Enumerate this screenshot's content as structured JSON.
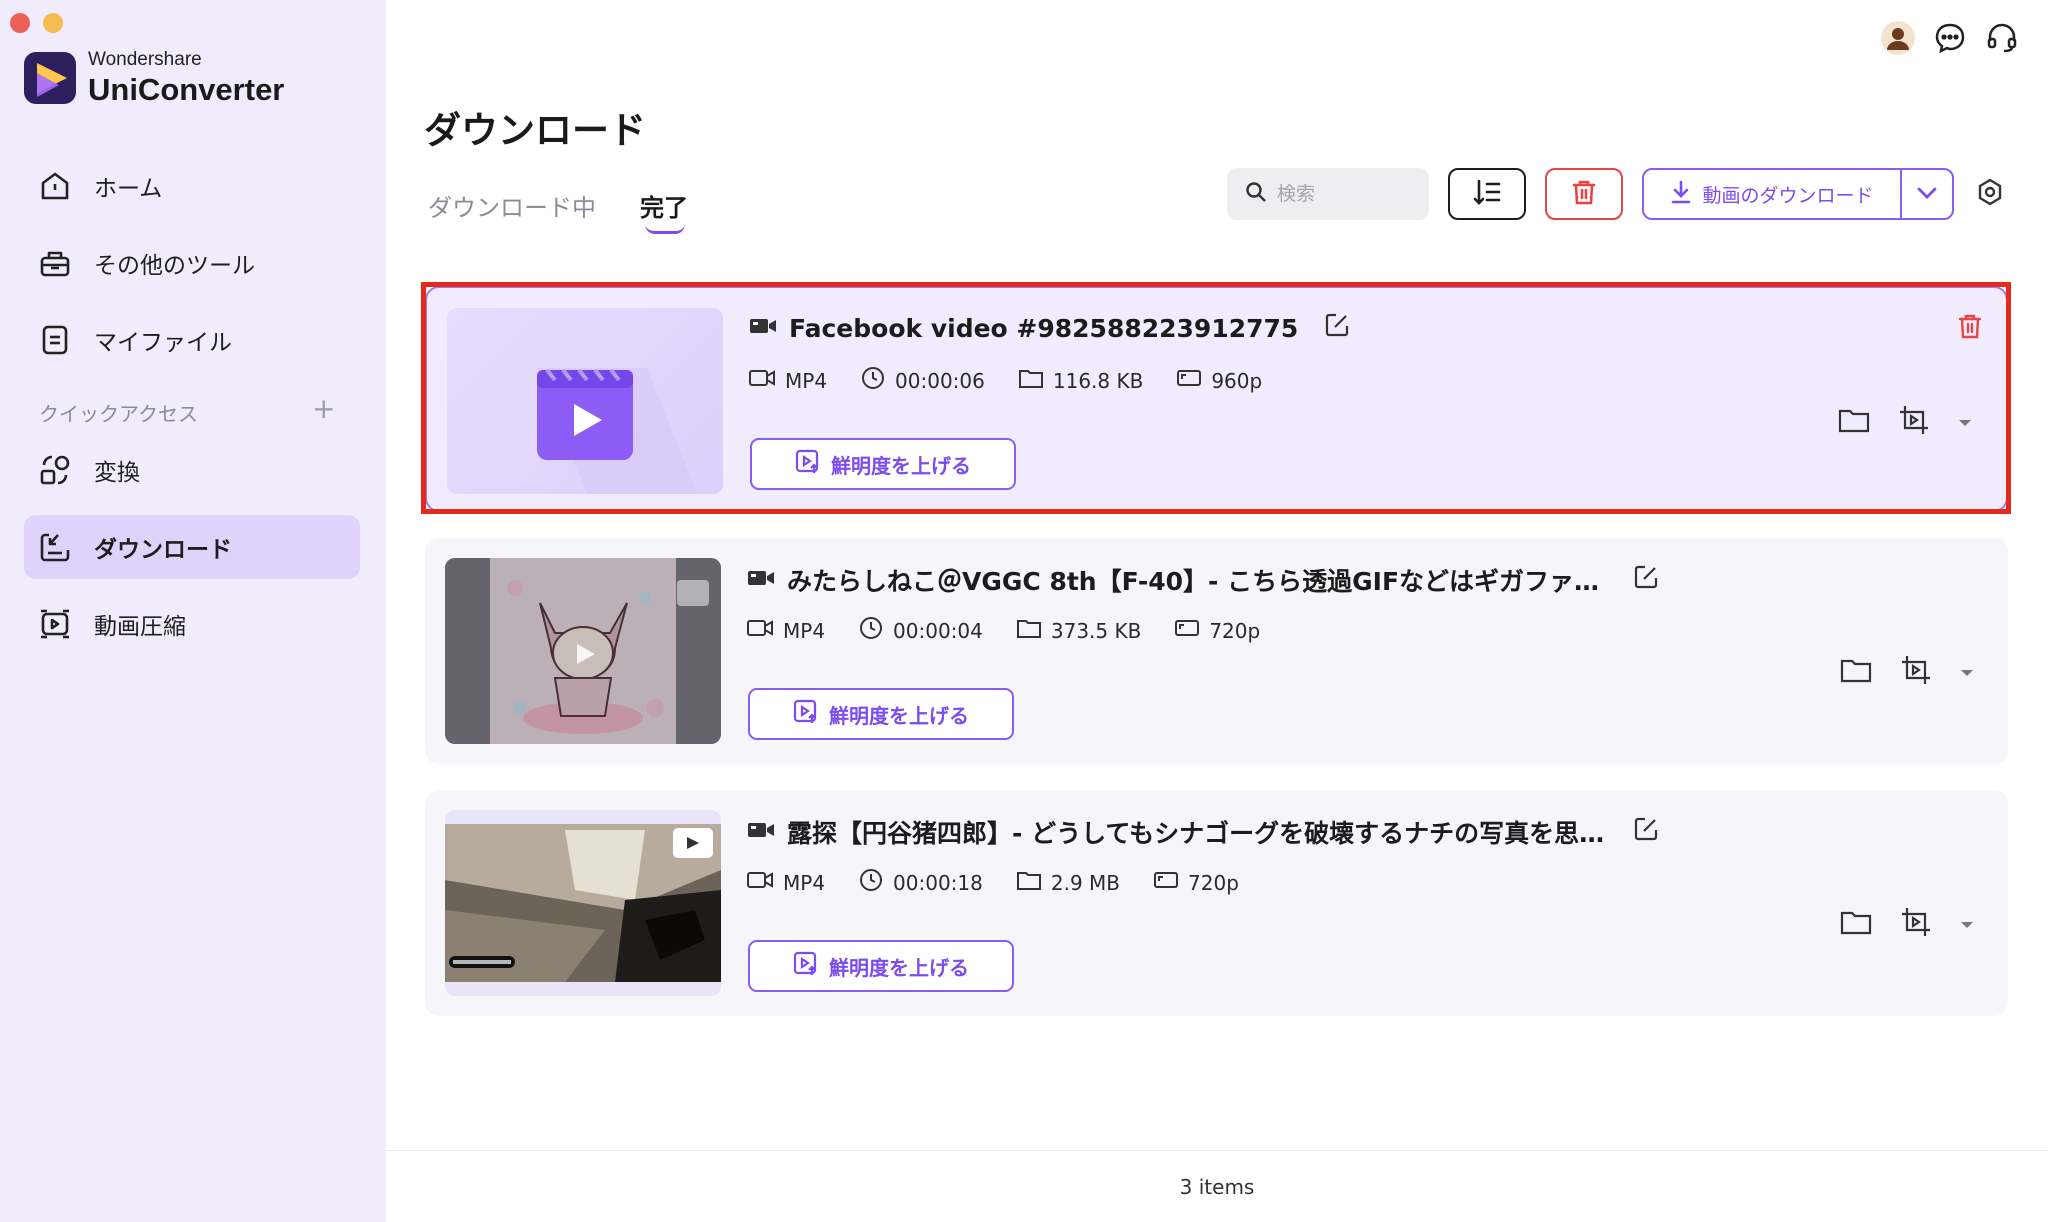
{
  "app": {
    "brand_sub": "Wondershare",
    "brand_main": "UniConverter"
  },
  "sidebar": {
    "items": [
      {
        "label": "ホーム",
        "icon": "home-icon"
      },
      {
        "label": "その他のツール",
        "icon": "toolbox-icon"
      },
      {
        "label": "マイファイル",
        "icon": "file-icon"
      }
    ],
    "quick_access_label": "クイックアクセス",
    "quick_items": [
      {
        "label": "変換",
        "icon": "convert-icon"
      },
      {
        "label": "ダウンロード",
        "icon": "download-icon",
        "active": true
      },
      {
        "label": "動画圧縮",
        "icon": "compress-icon"
      }
    ]
  },
  "header": {
    "title": "ダウンロード",
    "tabs": [
      {
        "label": "ダウンロード中",
        "active": false
      },
      {
        "label": "完了",
        "active": true
      }
    ],
    "search_placeholder": "検索",
    "download_button_label": "動画のダウンロード"
  },
  "items": [
    {
      "title": "Facebook video #982588223912775",
      "format": "MP4",
      "duration": "00:00:06",
      "size": "116.8 KB",
      "resolution": "960p",
      "enhance_label": "鮮明度を上げる"
    },
    {
      "title": "みたらしねこ＠VGGC 8th【F-40】- こちら透過GIFなどはギガファイ…",
      "format": "MP4",
      "duration": "00:00:04",
      "size": "373.5 KB",
      "resolution": "720p",
      "enhance_label": "鮮明度を上げる"
    },
    {
      "title": "露探【円谷猪四郎】- どうしてもシナゴーグを破壊するナチの写真を思い…",
      "format": "MP4",
      "duration": "00:00:18",
      "size": "2.9 MB",
      "resolution": "720p",
      "enhance_label": "鮮明度を上げる"
    }
  ],
  "footer": {
    "count": "3 items"
  },
  "colors": {
    "accent": "#7b4cf0",
    "danger": "#e64545",
    "sidebar_bg": "#f1ecfb",
    "active_nav": "#e0d2fb"
  }
}
